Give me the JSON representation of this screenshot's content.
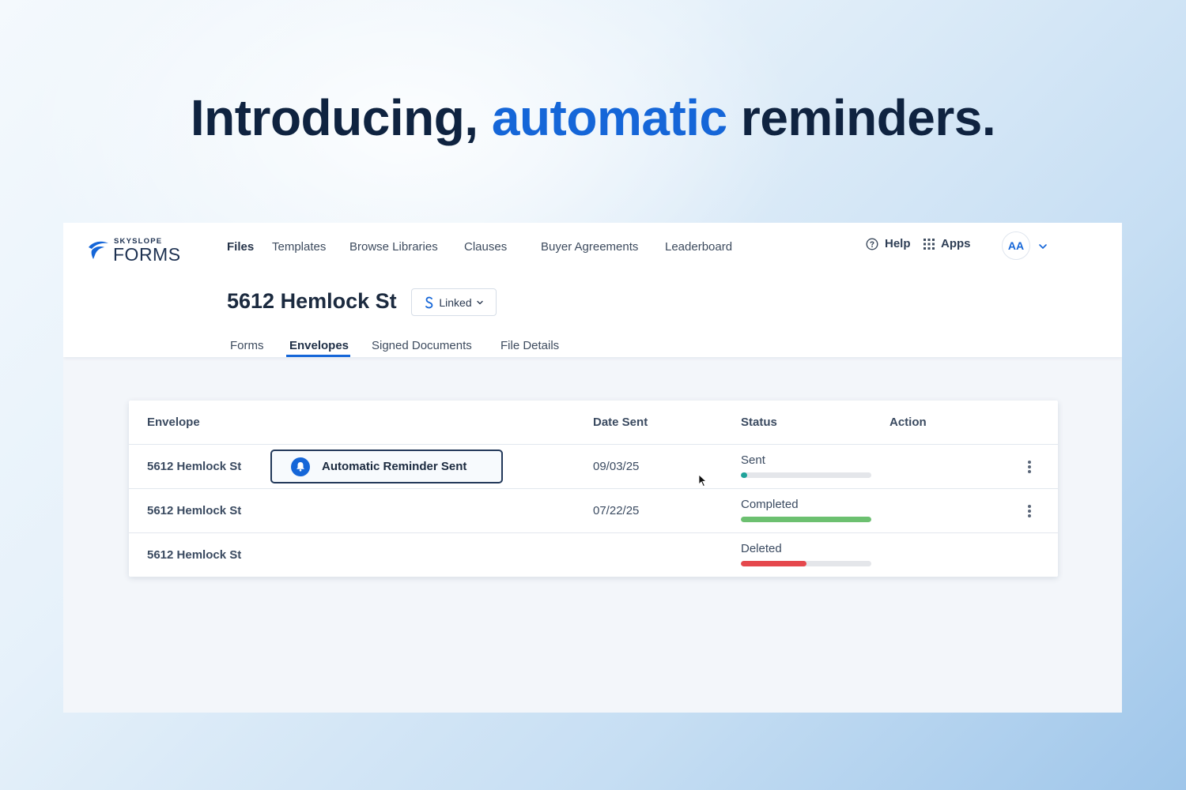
{
  "headline": {
    "part1": "Introducing, ",
    "accent": "automatic",
    "part2": " reminders.",
    "accent_color": "#1566d8"
  },
  "brand": {
    "small": "SKYSLOPE",
    "big": "FORMS"
  },
  "nav": {
    "items": [
      {
        "label": "Files",
        "active": true
      },
      {
        "label": "Templates"
      },
      {
        "label": "Browse Libraries"
      },
      {
        "label": "Clauses"
      },
      {
        "label": "Buyer Agreements"
      },
      {
        "label": "Leaderboard"
      }
    ],
    "help": "Help",
    "apps": "Apps",
    "avatar_initials": "AA"
  },
  "file": {
    "title": "5612 Hemlock St",
    "linked_label": "Linked"
  },
  "tabs": [
    {
      "label": "Forms"
    },
    {
      "label": "Envelopes",
      "active": true
    },
    {
      "label": "Signed Documents"
    },
    {
      "label": "File Details"
    }
  ],
  "table": {
    "headers": {
      "envelope": "Envelope",
      "date_sent": "Date Sent",
      "status": "Status",
      "action": "Action"
    },
    "rows": [
      {
        "envelope": "5612 Hemlock St",
        "date_sent": "09/03/25",
        "status": "Sent",
        "progress": 0.05,
        "bar_color": "#1fa39a",
        "has_action": true
      },
      {
        "envelope": "5612 Hemlock St",
        "date_sent": "07/22/25",
        "status": "Completed",
        "progress": 1.0,
        "bar_color": "#6cc070",
        "has_action": true
      },
      {
        "envelope": "5612 Hemlock St",
        "date_sent": "",
        "status": "Deleted",
        "progress": 0.5,
        "bar_color": "#e5484d",
        "has_action": false
      }
    ]
  },
  "toast": {
    "label": "Automatic Reminder Sent",
    "icon": "bell-icon"
  }
}
